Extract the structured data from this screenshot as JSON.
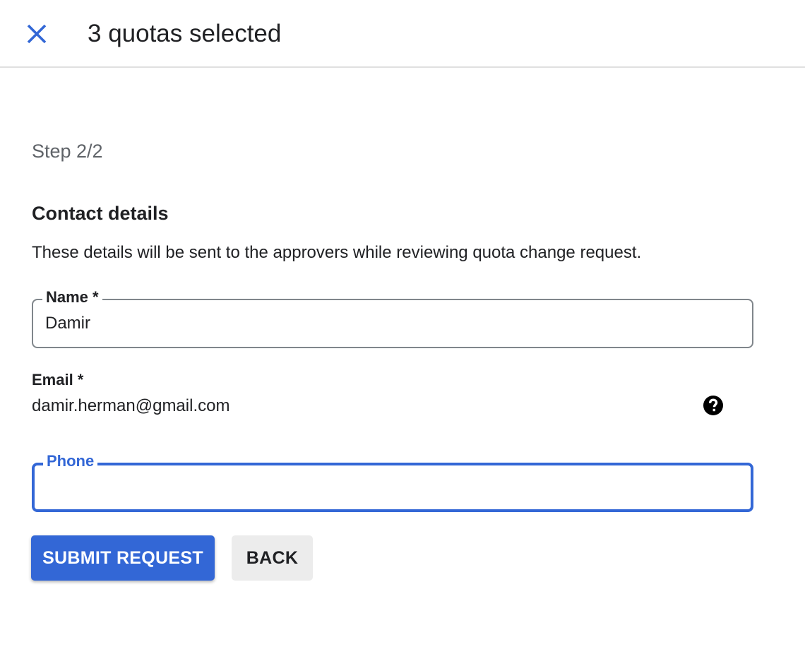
{
  "header": {
    "close_icon": "close-icon",
    "title": "3 quotas selected"
  },
  "step": "Step 2/2",
  "contact": {
    "title": "Contact details",
    "description": "These details will be sent to the approvers while reviewing quota change request."
  },
  "form": {
    "name": {
      "label": "Name *",
      "value": "Damir"
    },
    "email": {
      "label": "Email *",
      "value": "damir.herman@gmail.com",
      "help_icon": "help-circle-icon"
    },
    "phone": {
      "label": "Phone",
      "value": ""
    }
  },
  "buttons": {
    "submit": "SUBMIT REQUEST",
    "back": "BACK"
  },
  "colors": {
    "accent": "#3367d6",
    "text": "#202124",
    "secondary_text": "#5f6368",
    "border": "#80868b",
    "back_button_bg": "#ececec"
  }
}
